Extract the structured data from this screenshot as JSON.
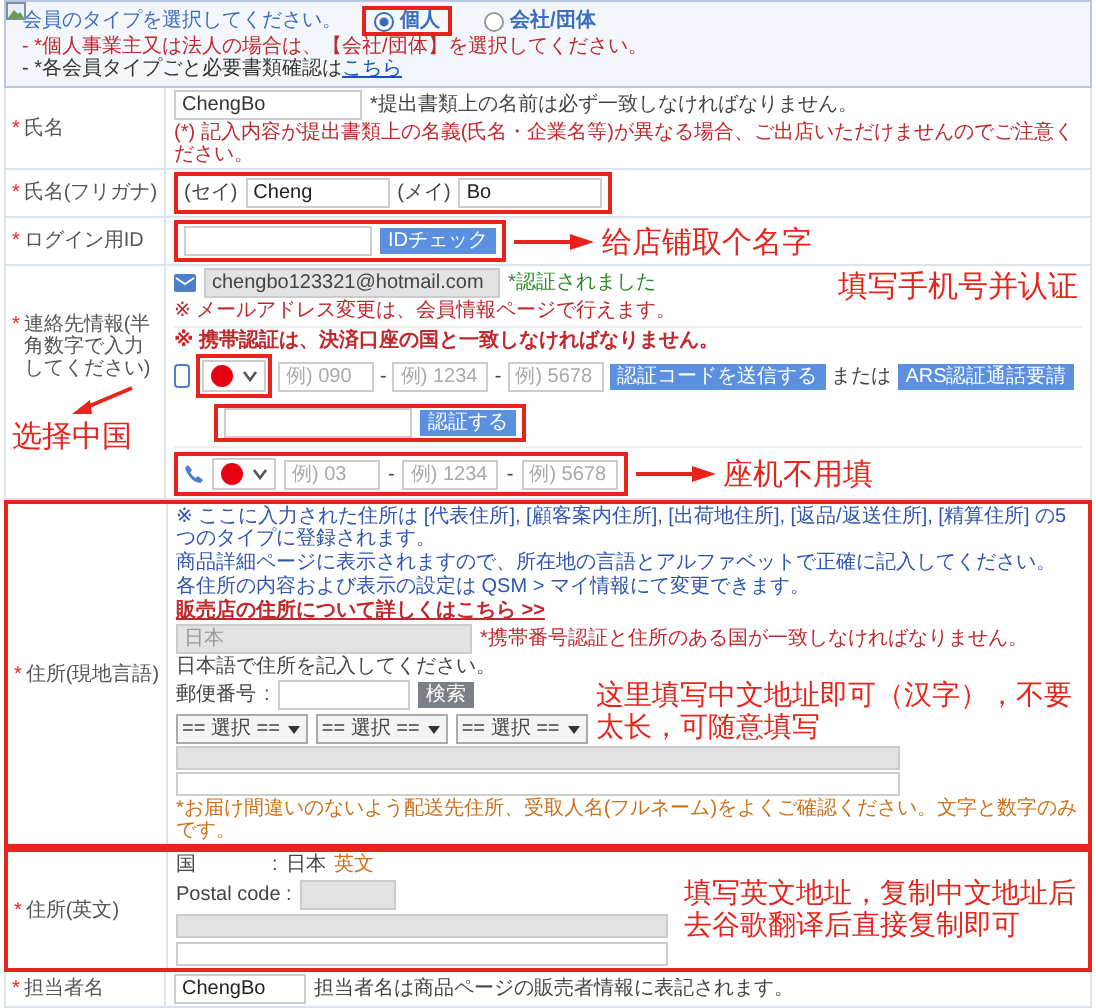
{
  "member_type": {
    "prompt": "会員のタイプを選択してください。",
    "options": [
      {
        "label": "個人",
        "selected": true,
        "highlighted": true
      },
      {
        "label": "会社/団体",
        "selected": false,
        "highlighted": false
      }
    ],
    "notes": [
      {
        "text": "- *個人事業主又は法人の場合は、【会社/団体】を選択してください。",
        "kind": "warning"
      },
      {
        "text": "- *各会員タイプごと必要書類確認は",
        "link": "こちら",
        "kind": "info"
      }
    ]
  },
  "name": {
    "required_mark": "*",
    "label": "氏名",
    "value": "ChengBo",
    "note": "*提出書類上の名前は必ず一致しなければなりません。",
    "warning": "(*) 記入内容が提出書類上の名義(氏名・企業名等)が異なる場合、ご出店いただけませんのでご注意ください。"
  },
  "furigana": {
    "required_mark": "*",
    "label": "氏名(フリガナ)",
    "highlighted": true,
    "parts": [
      {
        "prefix": "(セイ)",
        "value": "Cheng"
      },
      {
        "prefix": "(メイ)",
        "value": "Bo"
      }
    ]
  },
  "login_id": {
    "required_mark": "*",
    "label": "ログイン用ID",
    "highlighted": true,
    "button": "IDチェック",
    "annotation": "给店铺取个名字"
  },
  "contact": {
    "required_mark": "*",
    "label": "連絡先情報(半角数字で入力してください)",
    "annotation": "选择中国",
    "email": {
      "value": "chengbo123321@hotmail.com",
      "status": "*認証されました",
      "note": "※ メールアドレス変更は、会員情報ページで行えます。"
    },
    "mobile": {
      "separator": "-",
      "warning": "※ 携帯認証は、決済口座の国と一致しなければなりません。",
      "flag_highlighted": true,
      "placeholders": [
        "例) 090",
        "例) 1234",
        "例) 5678"
      ],
      "send_button": "認証コードを送信する",
      "or": "または",
      "ars_button": "ARS認証通話要請",
      "verify_button": "認証する",
      "verify_highlighted": true,
      "annotation": "填写手机号并认证"
    },
    "landline": {
      "separator": "-",
      "highlighted": true,
      "placeholders": [
        "例) 03",
        "例) 1234",
        "例) 5678"
      ],
      "annotation": "座机不用填"
    }
  },
  "address_local": {
    "required_mark": "*",
    "label": "住所(現地言語)",
    "highlighted": true,
    "notes": [
      "※ ここに入力された住所は [代表住所], [顧客案内住所], [出荷地住所], [返品/返送住所], [精算住所] の5つのタイプに登録されます。",
      "商品詳細ページに表示されますので、所在地の言語とアルファベットで正確に記入してください。",
      "各住所の内容および表示の設定は QSM > マイ情報にて変更できます。"
    ],
    "link": "販売店の住所について詳しくはこちら >>",
    "country": "日本",
    "country_note": "*携帯番号認証と住所のある国が一致しなければなりません。",
    "language_note": "日本語で住所を記入してください。",
    "postal_label": "郵便番号",
    "separator": ":",
    "search_button": "検索",
    "selects": [
      "== 選択 ==",
      "== 選択 ==",
      "== 選択 =="
    ],
    "footer_note": "*お届け間違いのないよう配送先住所、受取人名(フルネーム)をよくご確認ください。文字と数字のみです。",
    "annotation": "这里填写中文地址即可（汉字），不要太长，可随意填写"
  },
  "address_en": {
    "required_mark": "*",
    "label": "住所(英文)",
    "highlighted": true,
    "country_label": "国",
    "separator": ":",
    "country": "日本",
    "language_link": "英文",
    "postal_label": "Postal code :",
    "annotation": "填写英文地址，复制中文地址后去谷歌翻译后直接复制即可"
  },
  "manager": {
    "required_mark": "*",
    "label": "担当者名",
    "value": "ChengBo",
    "note": "担当者名は商品ページの販売者情報に表記されます。"
  }
}
